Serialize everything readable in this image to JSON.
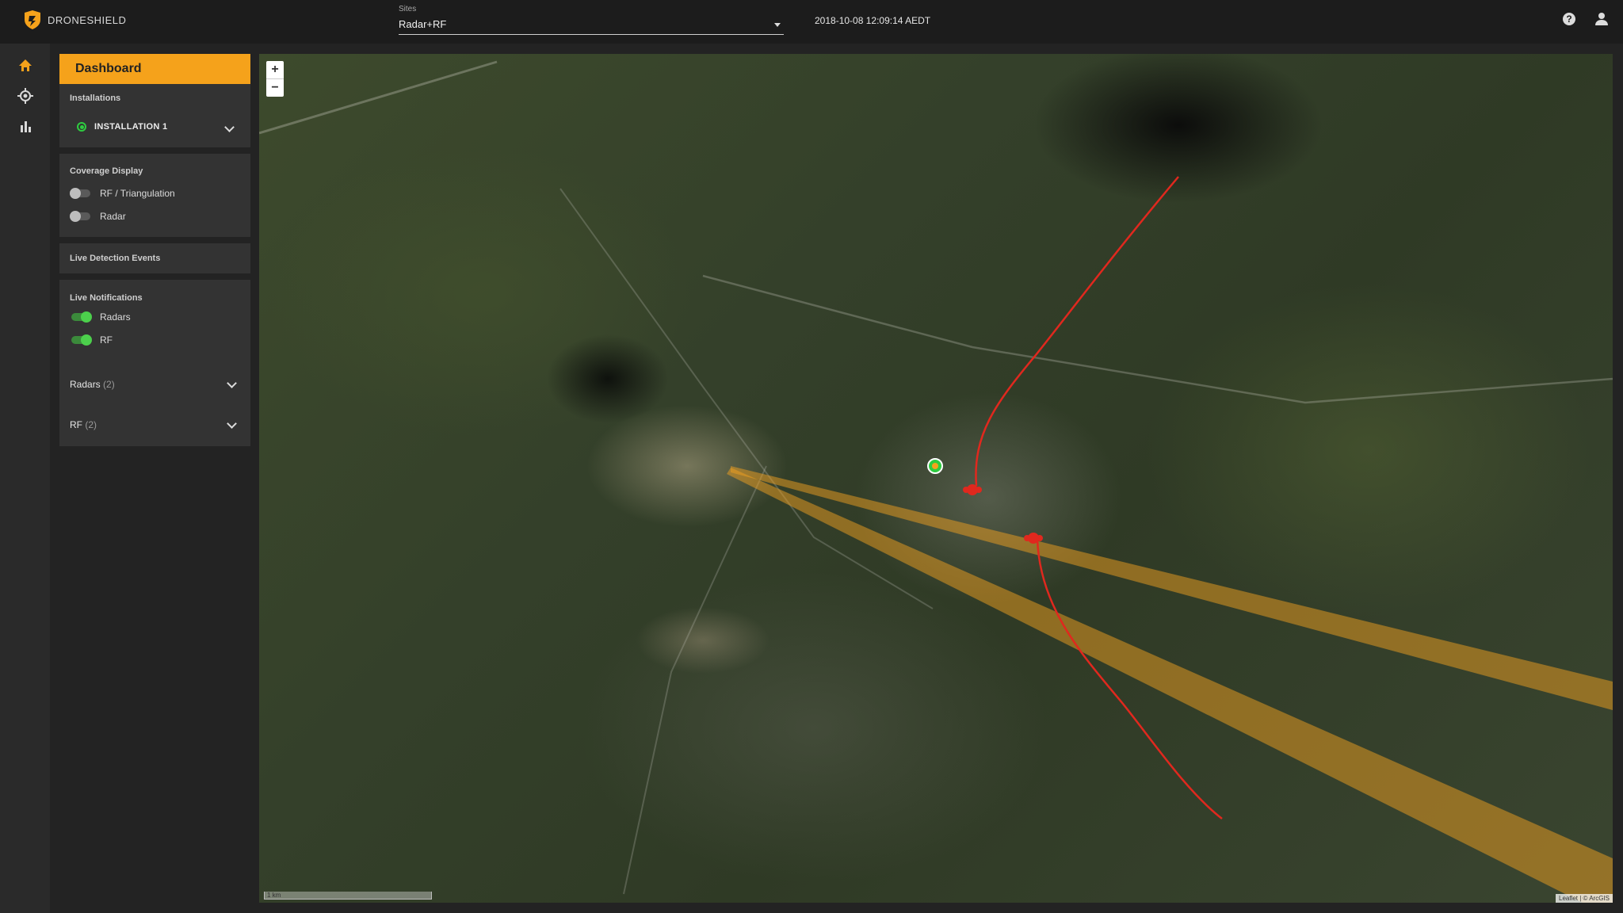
{
  "brand": {
    "name": "DRONESHIELD"
  },
  "topbar": {
    "sites_label": "Sites",
    "sites_value": "Radar+RF",
    "datetime": "2018-10-08 12:09:14 AEDT",
    "help_glyph": "?"
  },
  "sidebar": {
    "items": [
      {
        "icon": "home-icon",
        "active": true
      },
      {
        "icon": "target-icon",
        "active": false
      },
      {
        "icon": "bar-chart-icon",
        "active": false
      }
    ]
  },
  "panel": {
    "title": "Dashboard",
    "installations": {
      "title": "Installations",
      "selected": "INSTALLATION 1"
    },
    "coverage": {
      "title": "Coverage Display",
      "toggles": [
        {
          "label": "RF / Triangulation",
          "on": false
        },
        {
          "label": "Radar",
          "on": false
        }
      ]
    },
    "live_detection_events": {
      "title": "Live Detection Events"
    },
    "live_notifications": {
      "title": "Live Notifications",
      "toggles": [
        {
          "label": "Radars",
          "on": true
        },
        {
          "label": "RF",
          "on": true
        }
      ],
      "groups": [
        {
          "label": "Radars",
          "count": "(2)"
        },
        {
          "label": "RF",
          "count": "(2)"
        }
      ]
    }
  },
  "map": {
    "zoom_in": "+",
    "zoom_out": "−",
    "scale_label": "1 km",
    "attribution": "Leaflet | © ArcGIS"
  },
  "colors": {
    "accent": "#f5a21b",
    "toggle_on": "#4cd04c",
    "track_red": "#e0281e",
    "rf_beam": "#f0a020",
    "site_marker": "#2ecc40"
  }
}
